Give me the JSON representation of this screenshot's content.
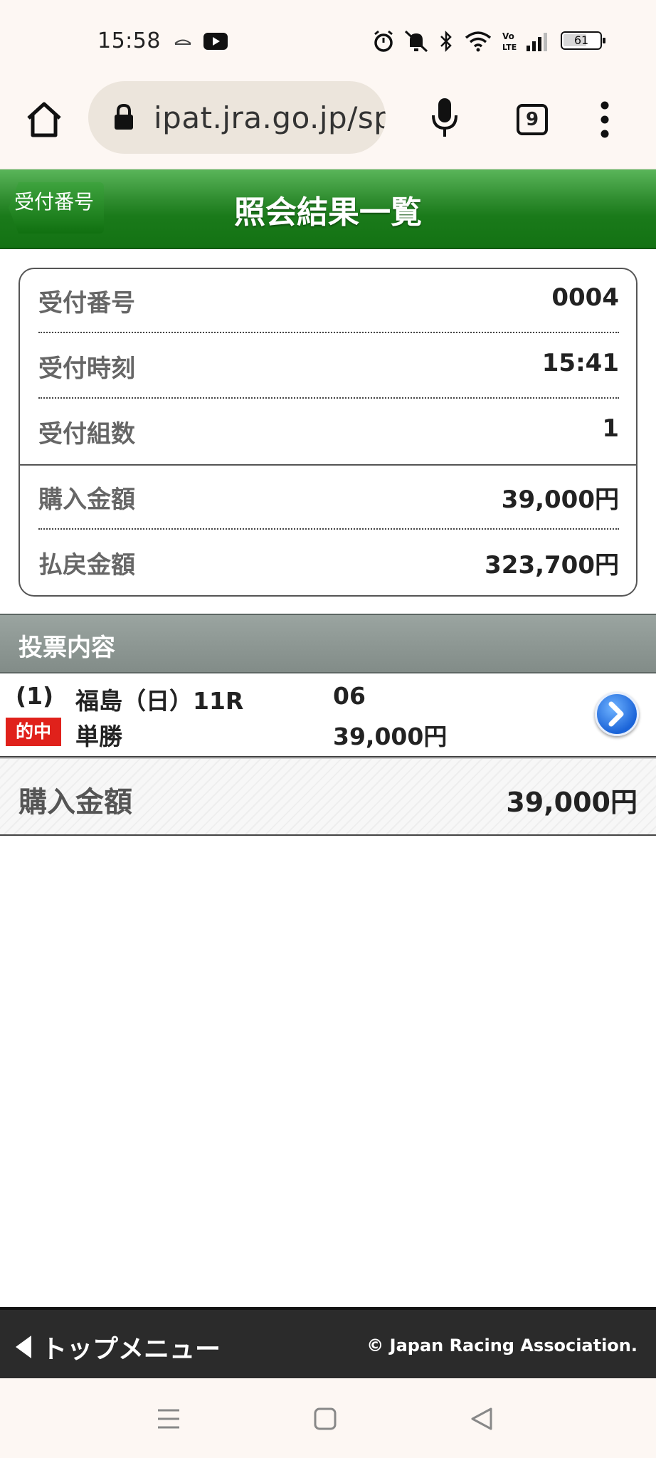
{
  "status_bar": {
    "time": "15:58",
    "battery": "61",
    "icons": [
      "wing-icon",
      "youtube-icon",
      "alarm-icon",
      "mute-icon",
      "bluetooth-icon",
      "wifi-icon",
      "volte-icon",
      "signal-icon",
      "battery-icon"
    ]
  },
  "browser": {
    "url": "ipat.jra.go.jp/sp",
    "tab_count": "9"
  },
  "header": {
    "back_label": "受付番号",
    "title": "照会結果一覧"
  },
  "summary": {
    "rows": [
      {
        "label": "受付番号",
        "value": "0004"
      },
      {
        "label": "受付時刻",
        "value": "15:41"
      },
      {
        "label": "受付組数",
        "value": "1"
      },
      {
        "label": "購入金額",
        "value": "39,000円"
      },
      {
        "label": "払戻金額",
        "value": "323,700円"
      }
    ]
  },
  "votes": {
    "section_title": "投票内容",
    "items": [
      {
        "index": "(1)",
        "race": "福島（日）11R",
        "horse": "06",
        "status": "的中",
        "bet_type": "単勝",
        "amount": "39,000円"
      }
    ]
  },
  "total": {
    "label": "購入金額",
    "value": "39,000円"
  },
  "footer": {
    "top_menu_label": "トップメニュー",
    "copyright": "© Japan Racing Association."
  },
  "colors": {
    "header_green": "#1a7a1a",
    "section_gray": "#8a9490",
    "hit_red": "#e0211b",
    "footer_dark": "#2b2b2b",
    "arrow_blue": "#1b64d8"
  }
}
